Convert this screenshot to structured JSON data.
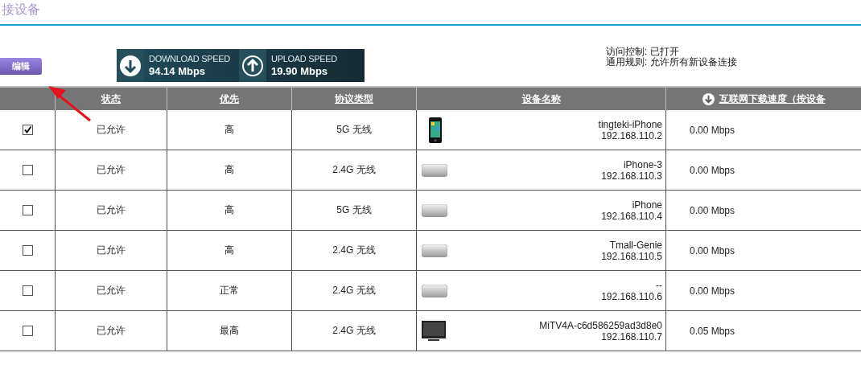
{
  "page_title": "接设备",
  "edit_button": "编辑",
  "speed": {
    "download_label": "DOWNLOAD SPEED",
    "download_value": "94.14 Mbps",
    "upload_label": "UPLOAD SPEED",
    "upload_value": "19.90 Mbps"
  },
  "info": [
    "访问控制: 已打开",
    "通用规则: 允许所有新设备连接"
  ],
  "table": {
    "columns": [
      "状态",
      "优先",
      "协议类型",
      "设备名称",
      "互联网下载速度（按设备"
    ],
    "rows": [
      {
        "checked": true,
        "status": "已允许",
        "priority": "高",
        "protocol": "5G 无线",
        "kind": "phone",
        "name": "tingteki-iPhone",
        "ip": "192.168.110.2",
        "speed": "0.00 Mbps"
      },
      {
        "checked": false,
        "status": "已允许",
        "priority": "高",
        "protocol": "2.4G 无线",
        "kind": "mini",
        "name": "iPhone-3",
        "ip": "192.168.110.3",
        "speed": "0.00 Mbps"
      },
      {
        "checked": false,
        "status": "已允许",
        "priority": "高",
        "protocol": "5G 无线",
        "kind": "mini",
        "name": "iPhone",
        "ip": "192.168.110.4",
        "speed": "0.00 Mbps"
      },
      {
        "checked": false,
        "status": "已允许",
        "priority": "高",
        "protocol": "2.4G 无线",
        "kind": "mini",
        "name": "Tmall-Genie",
        "ip": "192.168.110.5",
        "speed": "0.00 Mbps"
      },
      {
        "checked": false,
        "status": "已允许",
        "priority": "正常",
        "protocol": "2.4G 无线",
        "kind": "mini",
        "name": "--",
        "ip": "192.168.110.6",
        "speed": "0.00 Mbps"
      },
      {
        "checked": false,
        "status": "已允许",
        "priority": "最高",
        "protocol": "2.4G 无线",
        "kind": "tv",
        "name": "MiTV4A-c6d586259ad3d8e0",
        "ip": "192.168.110.7",
        "speed": "0.05 Mbps"
      }
    ]
  }
}
